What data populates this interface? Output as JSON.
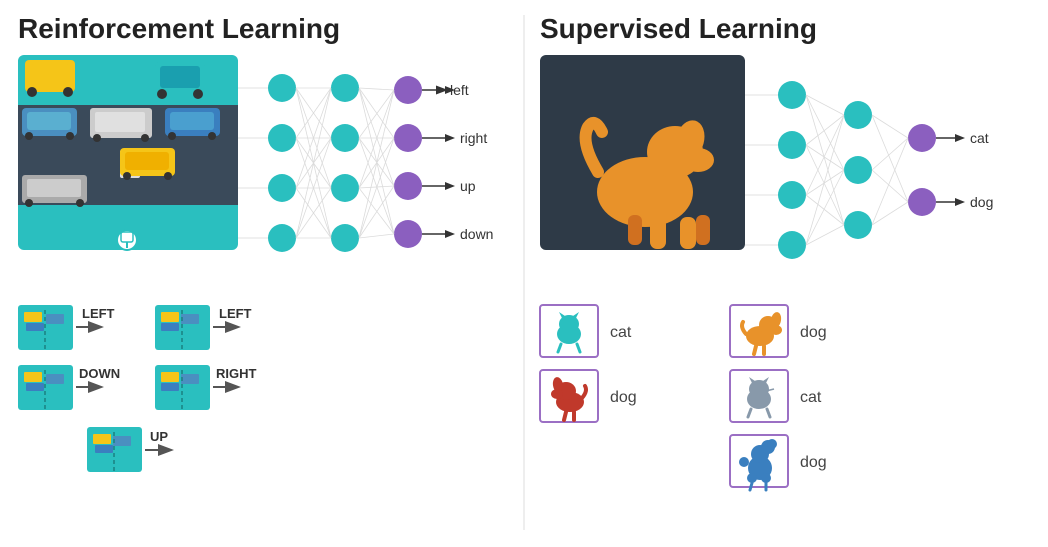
{
  "rl": {
    "title": "Reinforcement Learning",
    "outputs": [
      "left",
      "right",
      "up",
      "down"
    ],
    "examples": [
      {
        "label": "LEFT",
        "showArrow": true
      },
      {
        "label": "LEFT",
        "showArrow": true
      },
      {
        "label": "DOWN",
        "showArrow": true
      },
      {
        "label": "RIGHT",
        "showArrow": true
      },
      {
        "label": "UP",
        "showArrow": true
      }
    ]
  },
  "sl": {
    "title": "Supervised Learning",
    "outputs": [
      "cat",
      "dog"
    ],
    "examples": [
      {
        "animal": "cat",
        "color": "#2abfbf",
        "label": "cat"
      },
      {
        "animal": "dog",
        "color": "#e8a23a",
        "label": "dog"
      },
      {
        "animal": "dog2",
        "color": "#c0392b",
        "label": "dog"
      },
      {
        "animal": "cat2",
        "color": "#8899aa",
        "label": "cat"
      },
      {
        "animal": "dog3",
        "color": "#3a7fbf",
        "label": "dog"
      }
    ]
  }
}
